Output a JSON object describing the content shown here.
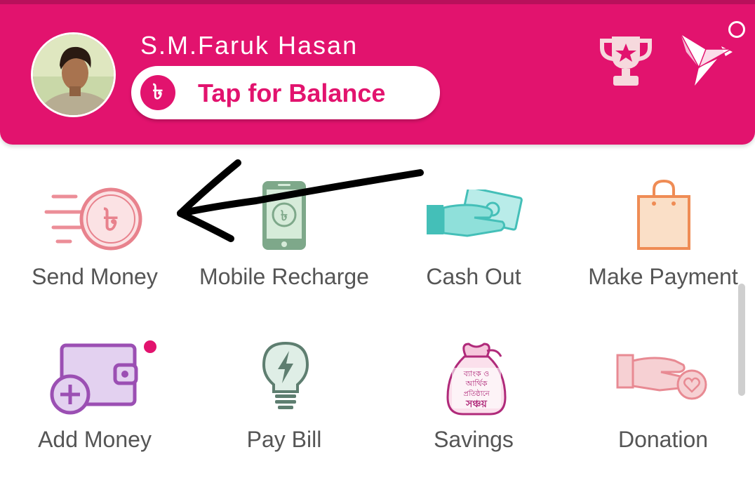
{
  "header": {
    "user_name": "S.M.Faruk Hasan",
    "balance_button_label": "Tap for Balance",
    "currency_symbol": "৳",
    "brand_color": "#e2136e"
  },
  "services": [
    {
      "label": "Send Money",
      "icon": "send-money-icon"
    },
    {
      "label": "Mobile Recharge",
      "icon": "mobile-recharge-icon"
    },
    {
      "label": "Cash Out",
      "icon": "cash-out-icon"
    },
    {
      "label": "Make Payment",
      "icon": "shopping-bag-icon"
    },
    {
      "label": "Add Money",
      "icon": "wallet-add-icon"
    },
    {
      "label": "Pay Bill",
      "icon": "bulb-icon"
    },
    {
      "label": "Savings",
      "icon": "savings-bag-icon",
      "bag_text": [
        "ব্যাংক ও",
        "আর্থিক",
        "প্রতিষ্ঠানে",
        "সঞ্চয়"
      ]
    },
    {
      "label": "Donation",
      "icon": "donation-hand-icon"
    }
  ]
}
